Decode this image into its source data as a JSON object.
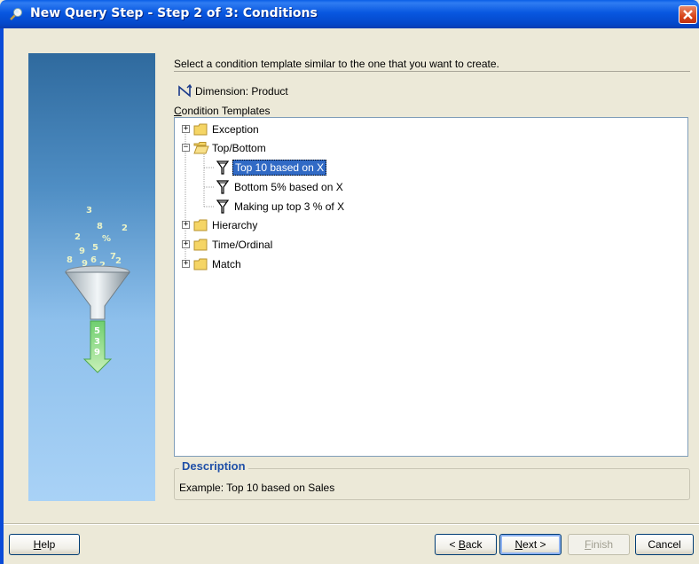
{
  "window": {
    "title": "New Query Step - Step 2 of 3: Conditions",
    "close_icon": "close-icon"
  },
  "instructions": "Select a condition template similar to the one that you want to create.",
  "dimension": {
    "icon": "dimension-icon",
    "label": "Dimension: Product"
  },
  "templates_label": "Condition Templates",
  "tree": {
    "nodes": [
      {
        "label": "Exception",
        "expander": "+"
      },
      {
        "label": "Top/Bottom",
        "expander": "−"
      },
      {
        "label": "Top 10 based on X",
        "selected": true
      },
      {
        "label": "Bottom 5% based on X"
      },
      {
        "label": "Making up top 3 % of X"
      },
      {
        "label": "Hierarchy",
        "expander": "+"
      },
      {
        "label": "Time/Ordinal",
        "expander": "+"
      },
      {
        "label": "Match",
        "expander": "+"
      }
    ]
  },
  "description": {
    "title": "Description",
    "text": "Example: Top 10 based on Sales"
  },
  "side_graphic": {
    "digits": [
      "3",
      "8",
      "2",
      "%",
      "9",
      "6",
      "7",
      "2",
      "5",
      "3",
      "9"
    ]
  },
  "buttons": {
    "help": "Help",
    "back": "< Back",
    "next": "Next >",
    "finish": "Finish",
    "cancel": "Cancel"
  }
}
